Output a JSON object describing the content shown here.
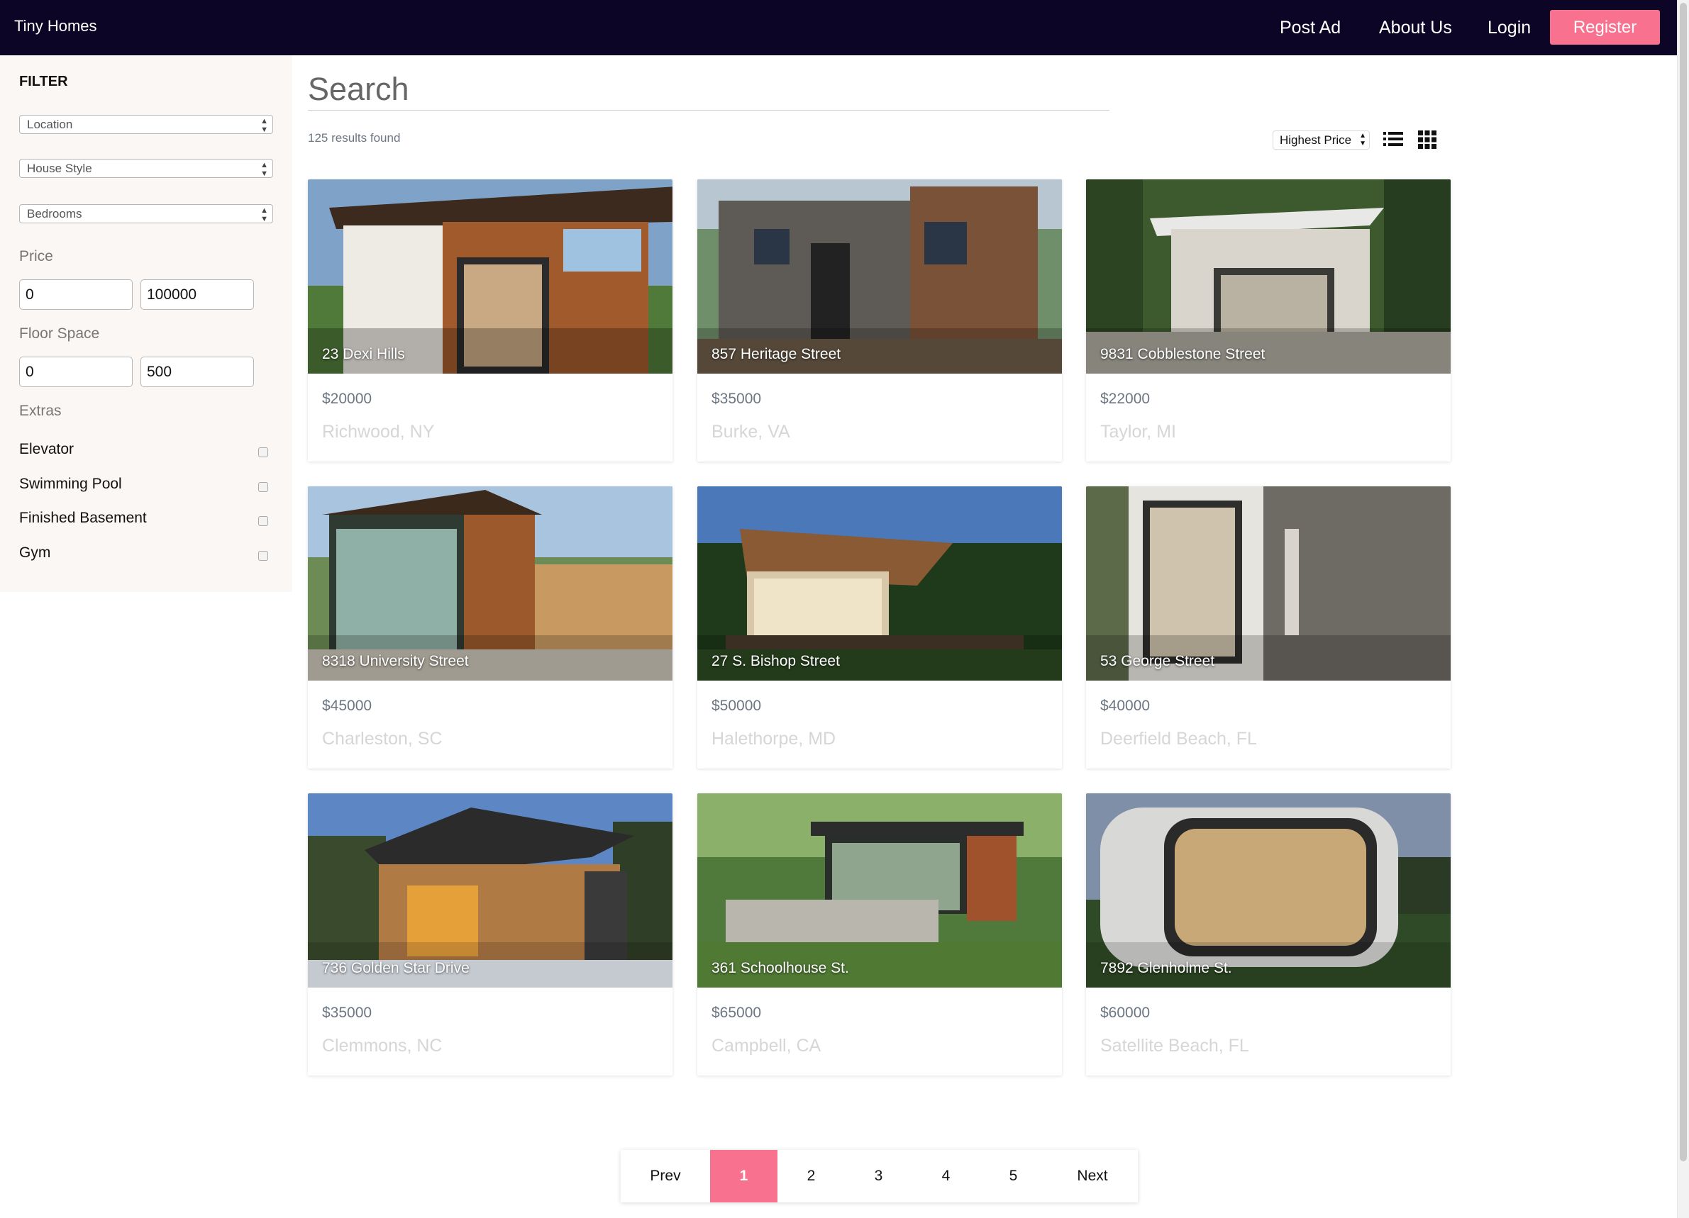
{
  "app": {
    "brand": "Tiny Homes"
  },
  "nav": {
    "post_ad": "Post Ad",
    "about_us": "About Us",
    "login": "Login",
    "register": "Register"
  },
  "sidebar": {
    "title": "FILTER",
    "location": "Location",
    "house_style": "House Style",
    "bedrooms": "Bedrooms",
    "price_label": "Price",
    "price_min": "0",
    "price_max": "100000",
    "floor_label": "Floor Space",
    "floor_min": "0",
    "floor_max": "500",
    "extras_label": "Extras",
    "extras": [
      "Elevator",
      "Swimming Pool",
      "Finished Basement",
      "Gym"
    ]
  },
  "main": {
    "search_title": "Search",
    "results_count": "125 results found",
    "sort": "Highest Price"
  },
  "listings": [
    {
      "address": "23 Dexi Hills",
      "price": "$20000",
      "city": "Richwood, NY"
    },
    {
      "address": "857 Heritage Street",
      "price": "$35000",
      "city": "Burke, VA"
    },
    {
      "address": "9831 Cobblestone Street",
      "price": "$22000",
      "city": "Taylor, MI"
    },
    {
      "address": "8318 University Street",
      "price": "$45000",
      "city": "Charleston, SC"
    },
    {
      "address": "27 S. Bishop Street",
      "price": "$50000",
      "city": "Halethorpe, MD"
    },
    {
      "address": "53 George Street",
      "price": "$40000",
      "city": "Deerfield Beach, FL"
    },
    {
      "address": "736 Golden Star Drive",
      "price": "$35000",
      "city": "Clemmons, NC"
    },
    {
      "address": "361 Schoolhouse St.",
      "price": "$65000",
      "city": "Campbell, CA"
    },
    {
      "address": "7892 Glenholme St.",
      "price": "$60000",
      "city": "Satellite Beach, FL"
    }
  ],
  "pagination": {
    "prev": "Prev",
    "pages": [
      "1",
      "2",
      "3",
      "4",
      "5"
    ],
    "next": "Next",
    "active": "1"
  },
  "colors": {
    "nav_bg": "#0d0526",
    "accent": "#f8718f",
    "sidebar_bg": "#fbf7f4"
  }
}
